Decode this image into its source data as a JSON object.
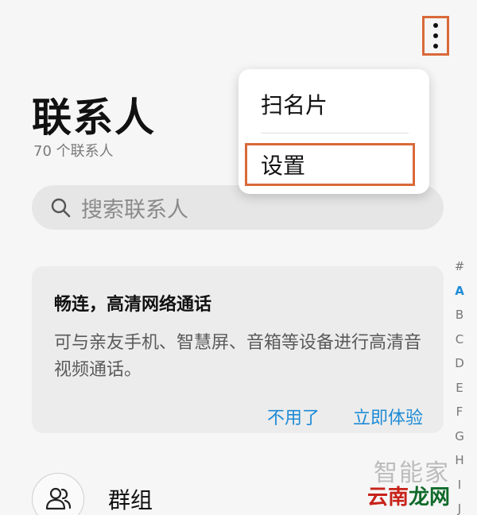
{
  "header": {
    "title": "联系人",
    "subtitle": "70 个联系人",
    "more_icon": "more-vertical-icon"
  },
  "menu": {
    "items": [
      {
        "label": "扫名片"
      },
      {
        "label": "设置"
      }
    ]
  },
  "search": {
    "placeholder": "搜索联系人",
    "icon": "search-icon"
  },
  "promo_card": {
    "title": "畅连，高清网络通话",
    "description": "可与亲友手机、智慧屏、音箱等设备进行高清音视频通话。",
    "dismiss_label": "不用了",
    "try_label": "立即体验"
  },
  "index_bar": {
    "letters": [
      "#",
      "A",
      "B",
      "C",
      "D",
      "E",
      "F",
      "G",
      "H",
      "I",
      "J"
    ],
    "active": "A"
  },
  "groups": {
    "label": "群组",
    "icon": "group-icon"
  },
  "watermark": {
    "line1": "智能家",
    "line2_red": "云南",
    "line2_green": "龙网"
  },
  "colors": {
    "accent_blue": "#1d8bd6",
    "highlight_orange": "#d9693a",
    "background": "#f6f6f6"
  }
}
